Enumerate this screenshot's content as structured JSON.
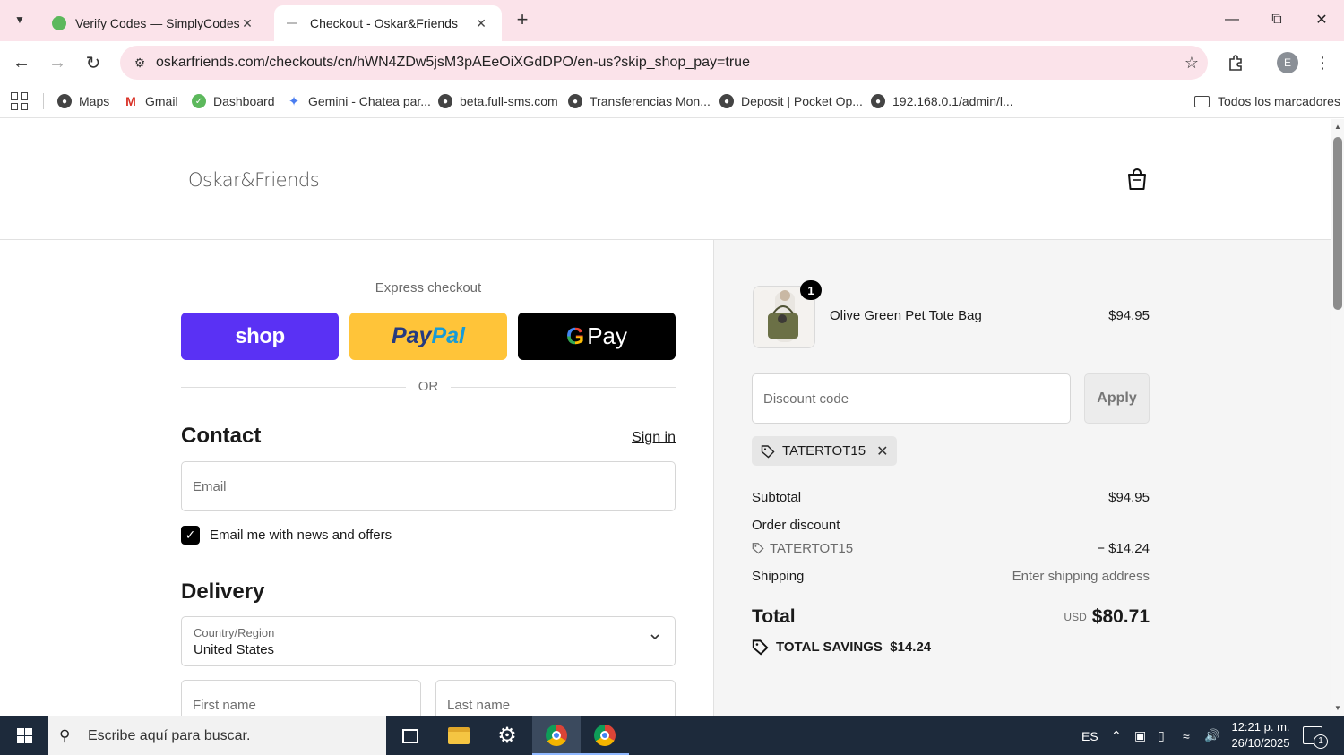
{
  "browser": {
    "tabs": [
      {
        "title": "Verify Codes — SimplyCodes",
        "active": false
      },
      {
        "title": "Checkout - Oskar&Friends",
        "active": true
      }
    ],
    "url": "oskarfriends.com/checkouts/cn/hWN4ZDw5jsM3pAEeOiXGdDPO/en-us?skip_shop_pay=true",
    "profile_initial": "E",
    "bookmarks": [
      {
        "label": "Maps",
        "icon": "maps-icon"
      },
      {
        "label": "Gmail",
        "icon": "gmail-icon"
      },
      {
        "label": "Dashboard",
        "icon": "dashboard-icon"
      },
      {
        "label": "Gemini - Chatea par...",
        "icon": "gemini-icon"
      },
      {
        "label": "beta.full-sms.com",
        "icon": "globe-icon"
      },
      {
        "label": "Transferencias Mon...",
        "icon": "globe-icon"
      },
      {
        "label": "Deposit | Pocket Op...",
        "icon": "globe-icon"
      },
      {
        "label": "192.168.0.1/admin/l...",
        "icon": "globe-icon"
      }
    ],
    "bookmarks_folder": "Todos los marcadores"
  },
  "store": {
    "logo_text": "Oskar&Friends"
  },
  "checkout": {
    "express_title": "Express checkout",
    "shop_label": "shop",
    "paypal_label_1": "Pay",
    "paypal_label_2": "Pal",
    "gpay_g": "G",
    "gpay_label": "Pay",
    "or_label": "OR",
    "contact_heading": "Contact",
    "sign_in": "Sign in",
    "email_placeholder": "Email",
    "newsletter_label": "Email me with news and offers",
    "newsletter_checked": true,
    "delivery_heading": "Delivery",
    "country_label": "Country/Region",
    "country_value": "United States",
    "first_name_placeholder": "First name",
    "last_name_placeholder": "Last name"
  },
  "summary": {
    "product": {
      "name": "Olive Green Pet Tote Bag",
      "price": "$94.95",
      "quantity": "1"
    },
    "discount_placeholder": "Discount code",
    "apply_label": "Apply",
    "applied_code": "TATERTOT15",
    "subtotal_label": "Subtotal",
    "subtotal_value": "$94.95",
    "order_discount_label": "Order discount",
    "discount_code": "TATERTOT15",
    "discount_value": "− $14.24",
    "shipping_label": "Shipping",
    "shipping_value": "Enter shipping address",
    "total_label": "Total",
    "total_currency": "USD",
    "total_value": "$80.71",
    "savings_label": "TOTAL SAVINGS",
    "savings_value": "$14.24"
  },
  "taskbar": {
    "search_placeholder": "Escribe aquí para buscar.",
    "language": "ES",
    "time": "12:21 p. m.",
    "date": "26/10/2025",
    "notification_count": "1"
  },
  "colors": {
    "tab_strip": "#fbe3ea",
    "shop_pay": "#5a31f4",
    "paypal": "#ffc439",
    "summary_bg": "#f5f5f5",
    "taskbar": "#1d2a3b"
  }
}
